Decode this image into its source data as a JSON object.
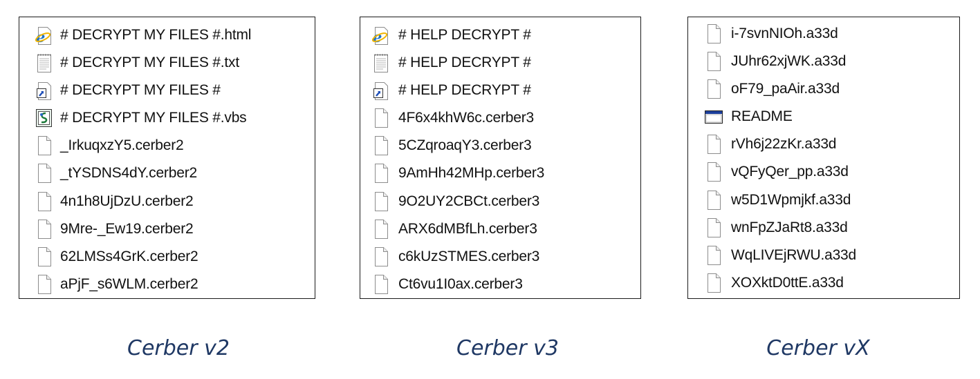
{
  "panels": [
    {
      "caption": "Cerber v2",
      "files": [
        {
          "name": "# DECRYPT MY FILES #.html",
          "icon": "ie-html-icon"
        },
        {
          "name": "# DECRYPT MY FILES #.txt",
          "icon": "text-file-icon"
        },
        {
          "name": "# DECRYPT MY FILES #",
          "icon": "shortcut-icon"
        },
        {
          "name": "# DECRYPT MY FILES #.vbs",
          "icon": "vbs-script-icon"
        },
        {
          "name": "_IrkuqxzY5.cerber2",
          "icon": "blank-file-icon"
        },
        {
          "name": "_tYSDNS4dY.cerber2",
          "icon": "blank-file-icon"
        },
        {
          "name": "4n1h8UjDzU.cerber2",
          "icon": "blank-file-icon"
        },
        {
          "name": "9Mre-_Ew19.cerber2",
          "icon": "blank-file-icon"
        },
        {
          "name": "62LMSs4GrK.cerber2",
          "icon": "blank-file-icon"
        },
        {
          "name": "aPjF_s6WLM.cerber2",
          "icon": "blank-file-icon"
        }
      ]
    },
    {
      "caption": "Cerber v3",
      "files": [
        {
          "name": "# HELP DECRYPT #",
          "icon": "ie-html-icon"
        },
        {
          "name": "# HELP DECRYPT #",
          "icon": "text-file-icon"
        },
        {
          "name": "# HELP DECRYPT #",
          "icon": "shortcut-icon"
        },
        {
          "name": "4F6x4khW6c.cerber3",
          "icon": "blank-file-icon"
        },
        {
          "name": "5CZqroaqY3.cerber3",
          "icon": "blank-file-icon"
        },
        {
          "name": "9AmHh42MHp.cerber3",
          "icon": "blank-file-icon"
        },
        {
          "name": "9O2UY2CBCt.cerber3",
          "icon": "blank-file-icon"
        },
        {
          "name": "ARX6dMBfLh.cerber3",
          "icon": "blank-file-icon"
        },
        {
          "name": "c6kUzSTMES.cerber3",
          "icon": "blank-file-icon"
        },
        {
          "name": "Ct6vu1I0ax.cerber3",
          "icon": "blank-file-icon"
        }
      ]
    },
    {
      "caption": "Cerber vX",
      "files": [
        {
          "name": "i-7svnNIOh.a33d",
          "icon": "blank-file-icon"
        },
        {
          "name": "JUhr62xjWK.a33d",
          "icon": "blank-file-icon"
        },
        {
          "name": "oF79_paAir.a33d",
          "icon": "blank-file-icon"
        },
        {
          "name": "README",
          "icon": "application-window-icon"
        },
        {
          "name": "rVh6j22zKr.a33d",
          "icon": "blank-file-icon"
        },
        {
          "name": "vQFyQer_pp.a33d",
          "icon": "blank-file-icon"
        },
        {
          "name": "w5D1Wpmjkf.a33d",
          "icon": "blank-file-icon"
        },
        {
          "name": "wnFpZJaRt8.a33d",
          "icon": "blank-file-icon"
        },
        {
          "name": "WqLIVEjRWU.a33d",
          "icon": "blank-file-icon"
        },
        {
          "name": "XOXktD0ttE.a33d",
          "icon": "blank-file-icon"
        }
      ]
    }
  ]
}
